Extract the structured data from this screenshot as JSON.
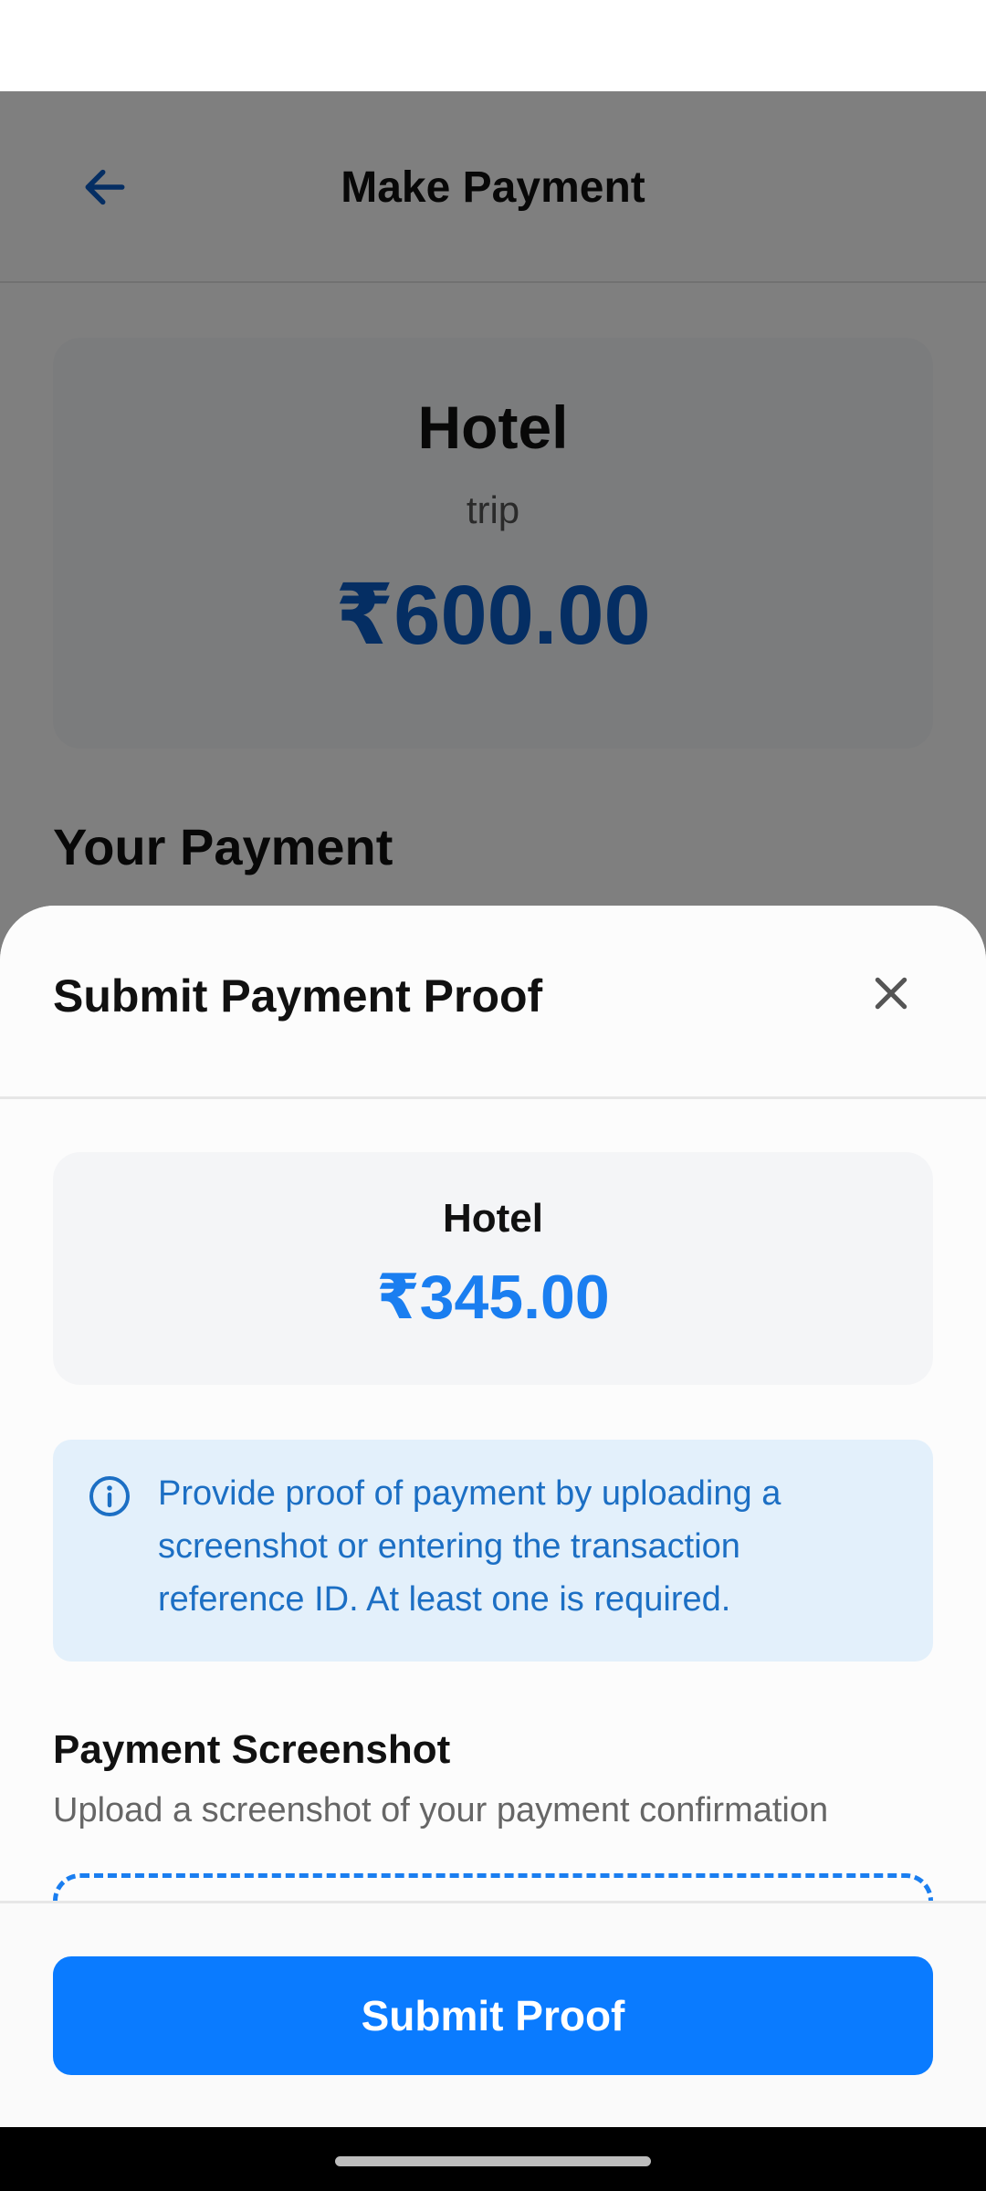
{
  "header": {
    "title": "Make Payment",
    "back_icon": "arrow-left-icon"
  },
  "expense_card": {
    "name": "Hotel",
    "group": "trip",
    "amount": "₹600.00"
  },
  "your_payment": {
    "heading": "Your Payment"
  },
  "sheet": {
    "title": "Submit Payment Proof",
    "close_icon": "close-icon",
    "summary": {
      "name": "Hotel",
      "amount": "₹345.00"
    },
    "info": {
      "icon": "info-icon",
      "text": "Provide proof of payment by uploading a screenshot or entering the transaction reference ID. At least one is required."
    },
    "screenshot": {
      "label": "Payment Screenshot",
      "help": "Upload a screenshot of your payment confirmation"
    },
    "submit_label": "Submit Proof"
  },
  "colors": {
    "primary": "#0a7bff",
    "amount_blue": "#1a7ef0",
    "info_bg": "#e3f0fb",
    "info_text": "#1c6fc4"
  }
}
